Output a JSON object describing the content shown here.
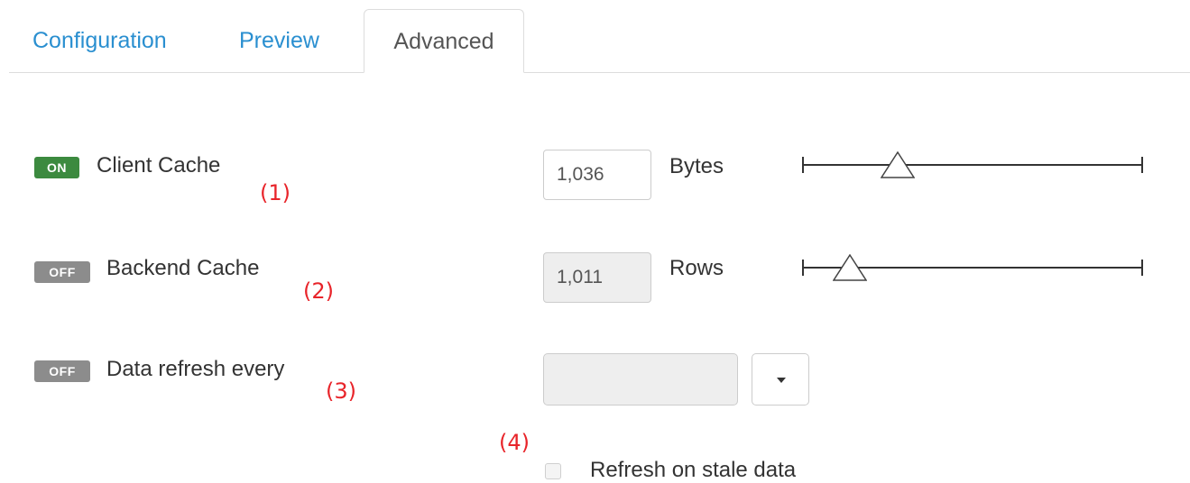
{
  "tabs": {
    "configuration": "Configuration",
    "preview": "Preview",
    "advanced": "Advanced"
  },
  "client_cache": {
    "toggle": "ON",
    "label": "Client Cache",
    "annotation": "(1)",
    "value": "1,036",
    "unit": "Bytes",
    "slider_fraction": 0.28
  },
  "backend_cache": {
    "toggle": "OFF",
    "label": "Backend Cache",
    "annotation": "(2)",
    "value": "1,011",
    "unit": "Rows",
    "slider_fraction": 0.14
  },
  "data_refresh": {
    "toggle": "OFF",
    "label": "Data refresh every",
    "annotation": "(3)",
    "value": ""
  },
  "stale": {
    "annotation": "(4)",
    "label": "Refresh on stale data",
    "checked": false
  },
  "colors": {
    "tab_link": "#2a8fd0",
    "toggle_on": "#3c8a3f",
    "toggle_off": "#8c8c8c",
    "annotation": "#e8242a"
  },
  "icons": {
    "dropdown": "caret-down-icon",
    "slider_thumb": "triangle-thumb-icon"
  }
}
